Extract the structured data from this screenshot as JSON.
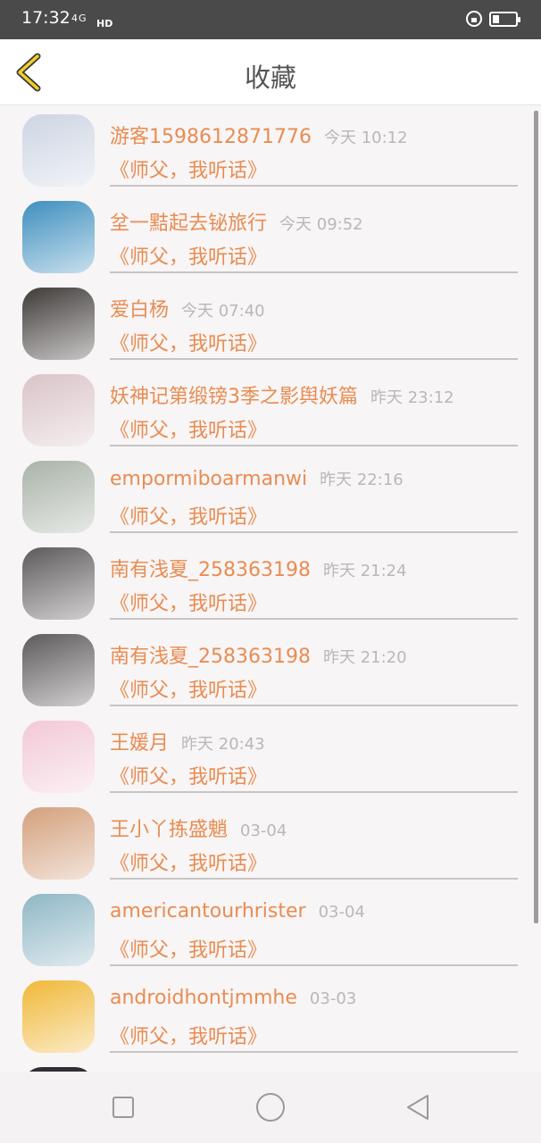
{
  "status_bar": {
    "time": "17:32",
    "signal": "4G",
    "network": "HD"
  },
  "header": {
    "title": "收藏",
    "back_icon": "chevron-left-icon"
  },
  "items": [
    {
      "name": "游客1598612871776",
      "time": "今天 10:12",
      "book": "《师父，我听话》",
      "avatar_color": "#cdd5e3"
    },
    {
      "name": "坌一黠起去铋旅行",
      "time": "今天 09:52",
      "book": "《师父，我听话》",
      "avatar_color": "#3e8fbf"
    },
    {
      "name": "爱白杨",
      "time": "今天 07:40",
      "book": "《师父，我听话》",
      "avatar_color": "#3f3a38"
    },
    {
      "name": "妖神记第缎镑3季之影舆妖篇",
      "time": "昨天 23:12",
      "book": "《师父，我听话》",
      "avatar_color": "#d9c4c8"
    },
    {
      "name": "empormiboarmanwi",
      "time": "昨天 22:16",
      "book": "《师父，我听话》",
      "avatar_color": "#a9b3a8"
    },
    {
      "name": "南有浅夏_258363198",
      "time": "昨天 21:24",
      "book": "《师父，我听话》",
      "avatar_color": "#5e5a5c"
    },
    {
      "name": "南有浅夏_258363198",
      "time": "昨天 21:20",
      "book": "《师父，我听话》",
      "avatar_color": "#5e5a5c"
    },
    {
      "name": "王媛月",
      "time": "昨天 20:43",
      "book": "《师父，我听话》",
      "avatar_color": "#f2c9d6"
    },
    {
      "name": "王小丫拣盛魈",
      "time": "03-04",
      "book": "《师父，我听话》",
      "avatar_color": "#d3a07c"
    },
    {
      "name": "americantourhrister",
      "time": "03-04",
      "book": "《师父，我听话》",
      "avatar_color": "#8fb7c6"
    },
    {
      "name": "androidhontjmmhe",
      "time": "03-03",
      "book": "《师父，我听话》",
      "avatar_color": "#f0b838"
    }
  ],
  "nav": {
    "recents_icon": "square-icon",
    "home_icon": "circle-icon",
    "back_icon": "triangle-back-icon"
  }
}
